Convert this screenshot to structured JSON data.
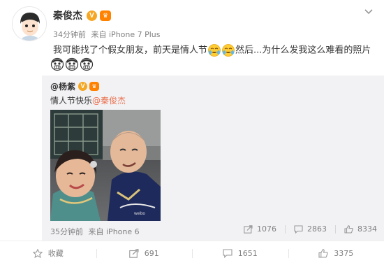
{
  "author": {
    "name": "秦俊杰",
    "verified_mark": "V",
    "member_mark": "♛",
    "time": "34分钟前",
    "source_prefix": "来自",
    "source_device": "iPhone 7 Plus"
  },
  "post": {
    "text_part1": "我可能找了个假女朋友，前天是情人节",
    "text_part2": "然后...为什么发我这么难看的照片"
  },
  "repost": {
    "author": "@杨紫",
    "verified_mark": "V",
    "member_mark": "♛",
    "text": "情人节快乐",
    "mention": "@秦俊杰",
    "time": "35分钟前",
    "source_prefix": "来自",
    "source_device": "iPhone 6",
    "reposts": "1076",
    "comments": "2863",
    "likes": "8334"
  },
  "toolbar": {
    "favorite_label": "收藏",
    "repost_count": "691",
    "comment_count": "1651",
    "like_count": "3375"
  },
  "colors": {
    "mention": "#eb7350",
    "meta_gray": "#808080",
    "repost_bg": "#f2f2f5",
    "verified_badge": "#f5a623"
  },
  "icons": [
    "chevron-down-icon",
    "star-icon",
    "repost-icon",
    "comment-icon",
    "like-icon",
    "crying-laughing-emoji",
    "grimace-emoji"
  ]
}
